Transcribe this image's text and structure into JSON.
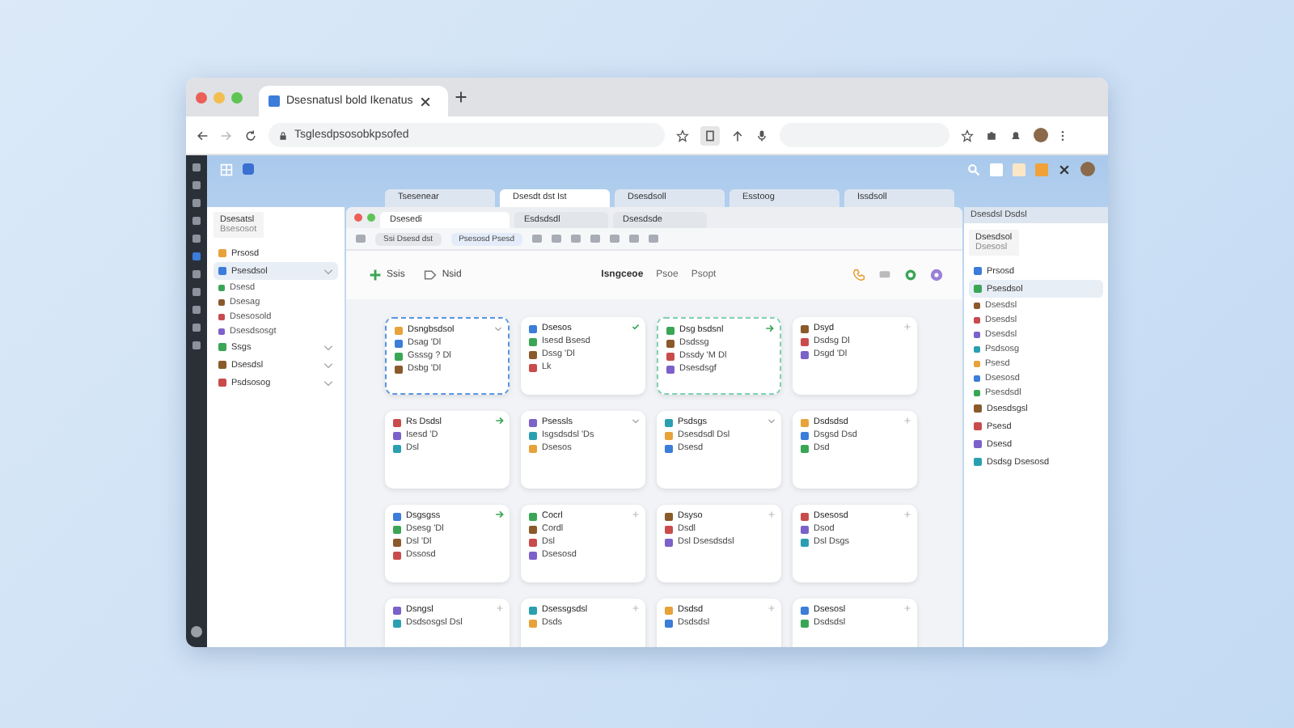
{
  "browser": {
    "tab_title": "Dsesnatusl bold Ikenatus",
    "url": "Tsglesdpsosobkpsofed"
  },
  "app_tabs": [
    {
      "label": "Tsesenear",
      "selected": false
    },
    {
      "label": "Dsesdt dst Ist",
      "selected": true
    },
    {
      "label": "Dsesdsoll",
      "selected": false
    },
    {
      "label": "Esstoog",
      "selected": false
    },
    {
      "label": "Issdsoll",
      "selected": false
    }
  ],
  "left_panel": {
    "title": "Dsesatsl",
    "subtitle": "Bsesosot",
    "items": [
      {
        "label": "Prsosd",
        "selected": false,
        "expandable": false
      },
      {
        "label": "Psesdsol",
        "selected": true,
        "expandable": true,
        "children": [
          {
            "label": "Dsesd"
          },
          {
            "label": "Dsesag"
          },
          {
            "label": "Dsesosold"
          },
          {
            "label": "Dsesdsosgt"
          }
        ]
      },
      {
        "label": "Ssgs",
        "selected": false,
        "expandable": true
      },
      {
        "label": "Dsesdsl",
        "selected": false,
        "expandable": true
      },
      {
        "label": "Psdsosog",
        "selected": false,
        "expandable": true
      }
    ]
  },
  "window": {
    "tabs": [
      {
        "label": "Dsesedi",
        "selected": true
      },
      {
        "label": "Esdsdsdl",
        "selected": false
      },
      {
        "label": "Dsesdsde",
        "selected": false
      }
    ],
    "chips": [
      "Ssi Dsesd dst",
      "Psesosd Psesd"
    ],
    "actions": [
      "Ssis",
      "Nsid"
    ],
    "crumbs": [
      "Isngceoe",
      "Psoe",
      "Psopt"
    ]
  },
  "cards": [
    {
      "kind": "selected",
      "corner": {
        "kind": "caret"
      },
      "lines": [
        "Dsngbsdsol",
        "Dsag 'Dl",
        "Gsssg ? Dl",
        "Dsbg 'Dl"
      ]
    },
    {
      "kind": "plain",
      "corner": {
        "kind": "check"
      },
      "lines": [
        "Dsesos",
        "Isesd Bsesd",
        "Dssg 'Dl",
        "Lk"
      ]
    },
    {
      "kind": "drop-target",
      "corner": {
        "kind": "arrow"
      },
      "lines": [
        "Dsg bsdsnl",
        "Dsdssg",
        "Dssdy 'M Dl",
        "Dsesdsgf"
      ]
    },
    {
      "kind": "plain",
      "corner": {
        "kind": "plus"
      },
      "lines": [
        "Dsyd",
        "Dsdsg Dl",
        "Dsgd 'Dl"
      ]
    },
    {
      "kind": "plain",
      "corner": {
        "kind": "arrow"
      },
      "lines": [
        "Rs Dsdsl",
        "Isesd 'D",
        "Dsl"
      ]
    },
    {
      "kind": "plain",
      "corner": {
        "kind": "caret"
      },
      "lines": [
        "Psessls",
        "Isgsdsdsl 'Ds",
        "Dsesos"
      ]
    },
    {
      "kind": "plain",
      "corner": {
        "kind": "caret"
      },
      "lines": [
        "Psdsgs",
        "Dsesdsdl Dsl",
        "Dsesd"
      ]
    },
    {
      "kind": "plain",
      "corner": {
        "kind": "plus"
      },
      "lines": [
        "Dsdsdsd",
        "Dsgsd Dsd",
        "Dsd"
      ]
    },
    {
      "kind": "plain",
      "corner": {
        "kind": "arrow"
      },
      "lines": [
        "Dsgsgss",
        "Dsesg 'Dl",
        "Dsl 'Dl",
        "Dssosd"
      ]
    },
    {
      "kind": "plain",
      "corner": {
        "kind": "plus"
      },
      "lines": [
        "Cocrl",
        "Cordl",
        "Dsl",
        "Dsesosd"
      ]
    },
    {
      "kind": "plain",
      "corner": {
        "kind": "plus"
      },
      "lines": [
        "Dsyso",
        "Dsdl",
        "Dsl Dsesdsdsl"
      ]
    },
    {
      "kind": "plain",
      "corner": {
        "kind": "plus"
      },
      "lines": [
        "Dsesosd",
        "Dsod",
        "Dsl Dsgs"
      ]
    },
    {
      "kind": "plain",
      "corner": {
        "kind": "plus"
      },
      "lines": [
        "Dsngsl",
        "Dsdsosgsl Dsl"
      ]
    },
    {
      "kind": "plain",
      "corner": {
        "kind": "plus"
      },
      "lines": [
        "Dsessgsdsl",
        "Dsds"
      ]
    },
    {
      "kind": "plain",
      "corner": {
        "kind": "plus"
      },
      "lines": [
        "Dsdsd",
        "Dsdsdsl"
      ]
    },
    {
      "kind": "plain",
      "corner": {
        "kind": "plus"
      },
      "lines": [
        "Dsesosl",
        "Dsdsdsl"
      ]
    }
  ],
  "right_panel": {
    "tab": "Dsesdsl Dsdsl",
    "title": "Dsesdsol",
    "subtitle": "Dsesosl",
    "items": [
      {
        "label": "Prsosd",
        "selected": false
      },
      {
        "label": "Psesdsol",
        "selected": true,
        "children": [
          {
            "label": "Dsesdsl"
          },
          {
            "label": "Dsesdsl"
          },
          {
            "label": "Dsesdsl"
          },
          {
            "label": "Psdsosg"
          },
          {
            "label": "Psesd"
          },
          {
            "label": "Dsesosd"
          },
          {
            "label": "Psesdsdl"
          }
        ]
      },
      {
        "label": "Dsesdsgsl",
        "selected": false
      },
      {
        "label": "Psesd",
        "selected": false
      },
      {
        "label": "Dsesd",
        "selected": false
      },
      {
        "label": "Dsdsg Dsesosd",
        "selected": false
      }
    ]
  }
}
